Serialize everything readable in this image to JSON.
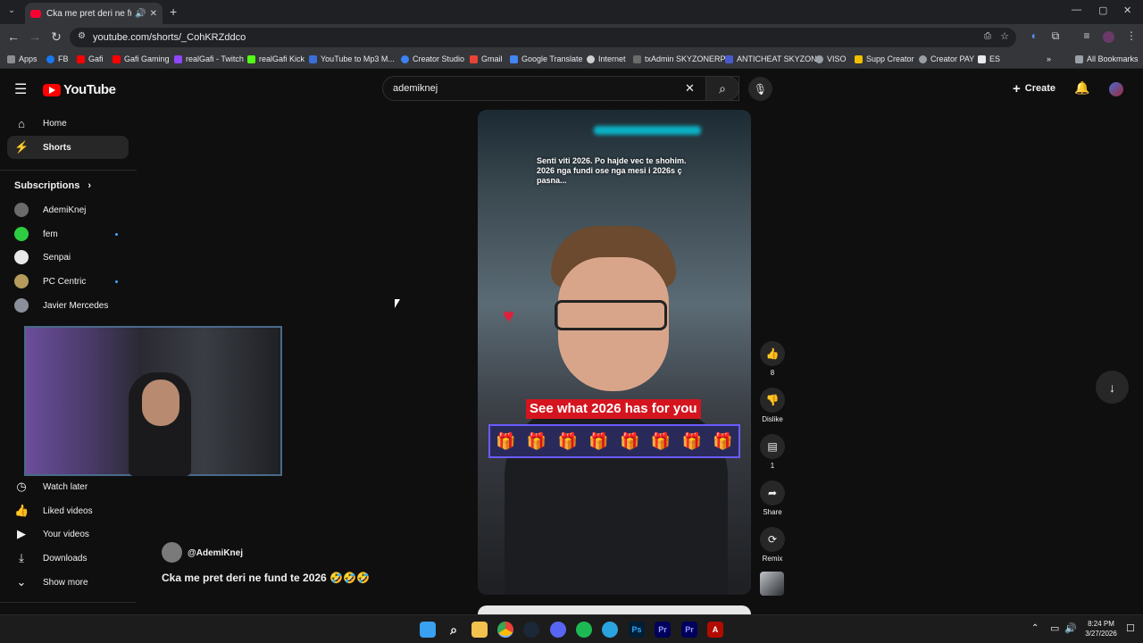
{
  "browser": {
    "tab_title": "Cka me pret deri ne fund te",
    "url": "youtube.com/shorts/_CohKRZddco",
    "bookmarks": [
      "Apps",
      "FB",
      "Gafi",
      "Gafi Gaming",
      "realGafi - Twitch",
      "realGafi Kick",
      "YouTube to Mp3 M...",
      "Creator Studio",
      "Gmail",
      "Google Translate",
      "Internet",
      "txAdmin SKYZONERP",
      "ANTICHEAT SKYZONE",
      "VISO",
      "Supp Creator",
      "Creator PAY",
      "ES"
    ],
    "all_bookmarks": "All Bookmarks"
  },
  "youtube": {
    "logo": "YouTube",
    "search_value": "ademiknej",
    "create_label": "Create",
    "sidebar": {
      "home": "Home",
      "shorts": "Shorts",
      "subscriptions": "Subscriptions",
      "subs": [
        {
          "name": "AdemiKnej",
          "color": "#6b6b6b",
          "dot": false
        },
        {
          "name": "fem",
          "color": "#2ecc40",
          "dot": true
        },
        {
          "name": "Senpai",
          "color": "#e8e8e8",
          "dot": false
        },
        {
          "name": "PC Centric",
          "color": "#b59c5c",
          "dot": true
        },
        {
          "name": "Javier Mercedes",
          "color": "#8a8f9a",
          "dot": false
        }
      ],
      "watch_later": "Watch later",
      "liked_videos": "Liked videos",
      "your_videos": "Your videos",
      "downloads": "Downloads",
      "show_more": "Show more"
    },
    "short": {
      "caption_top": "Senti viti 2026. Po hajde vec te shohim. 2026 nga fundi ose nga mesi i 2026s ç pasna...",
      "banner": "See what 2026 has for you",
      "channel": "@AdemiKnej",
      "title": "Cka me pret deri ne fund te 2026 🤣🤣🤣"
    },
    "actions": {
      "likes": "8",
      "dislike": "Dislike",
      "comments": "1",
      "share": "Share",
      "remix": "Remix"
    }
  },
  "taskbar": {
    "time": "8:24 PM",
    "date": "3/27/2026"
  }
}
